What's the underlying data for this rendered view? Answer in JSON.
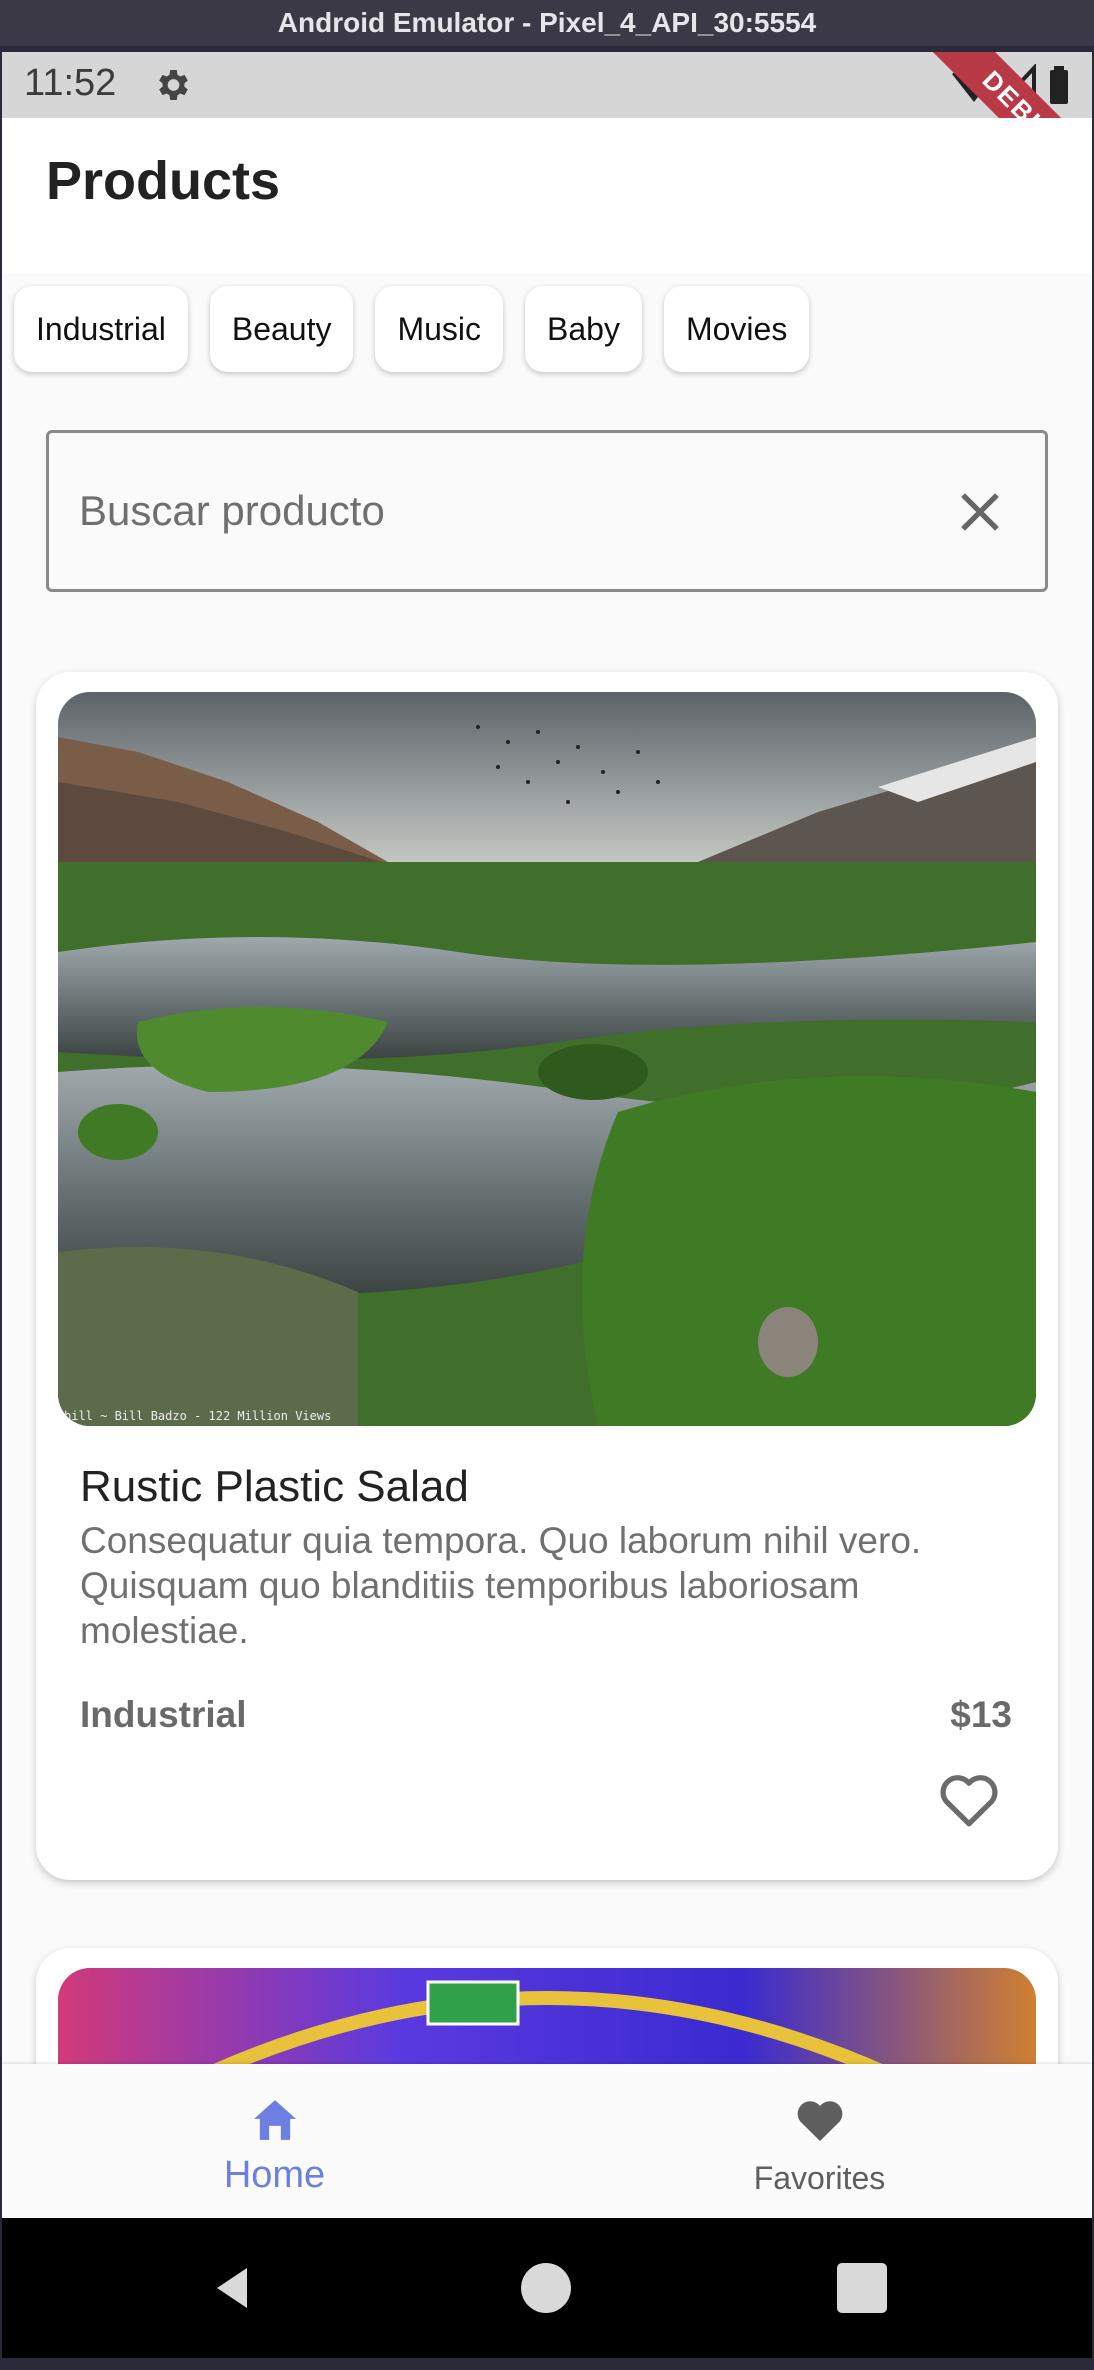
{
  "window": {
    "title": "Android Emulator - Pixel_4_API_30:5554"
  },
  "status_bar": {
    "time": "11:52",
    "debug_label": "DEBUG"
  },
  "app_bar": {
    "title": "Products"
  },
  "categories": [
    "Industrial",
    "Beauty",
    "Music",
    "Baby",
    "Movies"
  ],
  "search": {
    "placeholder": "Buscar producto",
    "value": ""
  },
  "product": {
    "name": "Rustic Plastic Salad",
    "description": "Consequatur quia tempora. Quo laborum nihil vero. Quisquam quo blanditiis temporibus laboriosam molestiae.",
    "category": "Industrial",
    "price": "$13",
    "image_watermark": "bill ~ Bill Badzo - 122 Million Views"
  },
  "bottom_nav": {
    "home_label": "Home",
    "favorites_label": "Favorites"
  },
  "colors": {
    "accent": "#6d7fe0",
    "debug": "#b73a46",
    "icon_gray": "#5e5e5e"
  }
}
